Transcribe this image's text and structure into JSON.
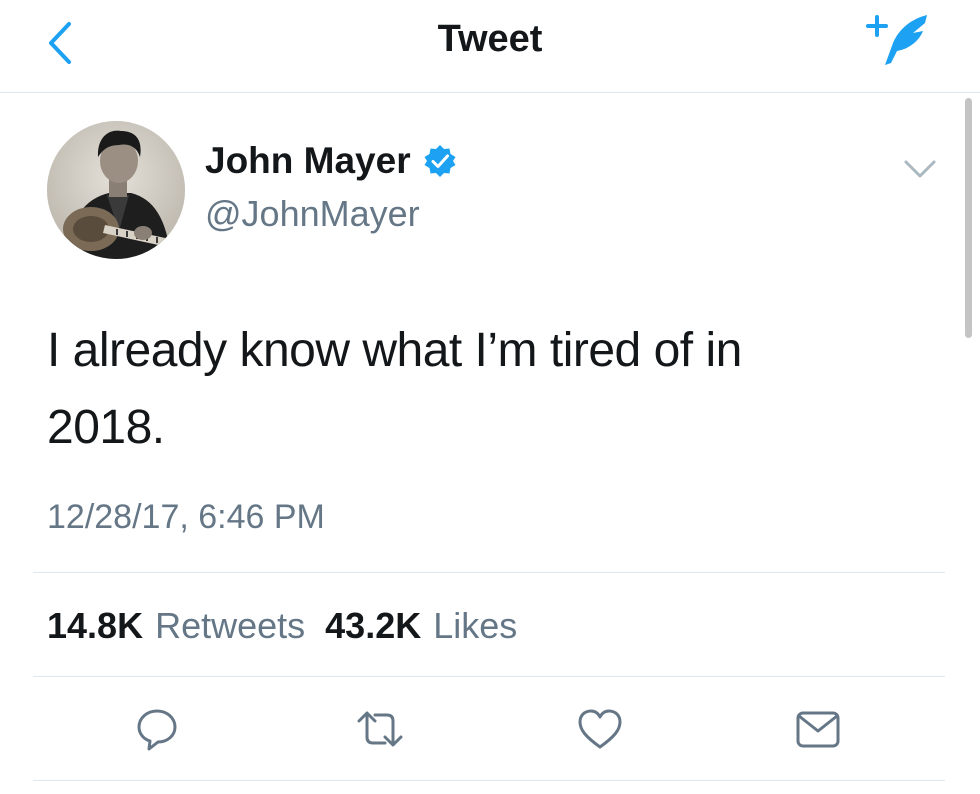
{
  "header": {
    "title": "Tweet",
    "back_icon": "chevron-left-icon",
    "compose_icon": "compose-feather-icon"
  },
  "author": {
    "name": "John Mayer",
    "handle": "@JohnMayer",
    "verified": true
  },
  "tweet": {
    "text_line1": "I already know what I’m tired of in",
    "text_line2": "2018.",
    "timestamp": "12/28/17, 6:46 PM"
  },
  "stats": {
    "retweets_count": "14.8K",
    "retweets_label": "Retweets",
    "likes_count": "43.2K",
    "likes_label": "Likes"
  },
  "actions": [
    "reply-icon",
    "retweet-icon",
    "like-icon",
    "share-icon"
  ],
  "colors": {
    "accent": "#1da1f2",
    "text": "#14171a",
    "secondary": "#657786",
    "divider": "#e1e8ed"
  }
}
